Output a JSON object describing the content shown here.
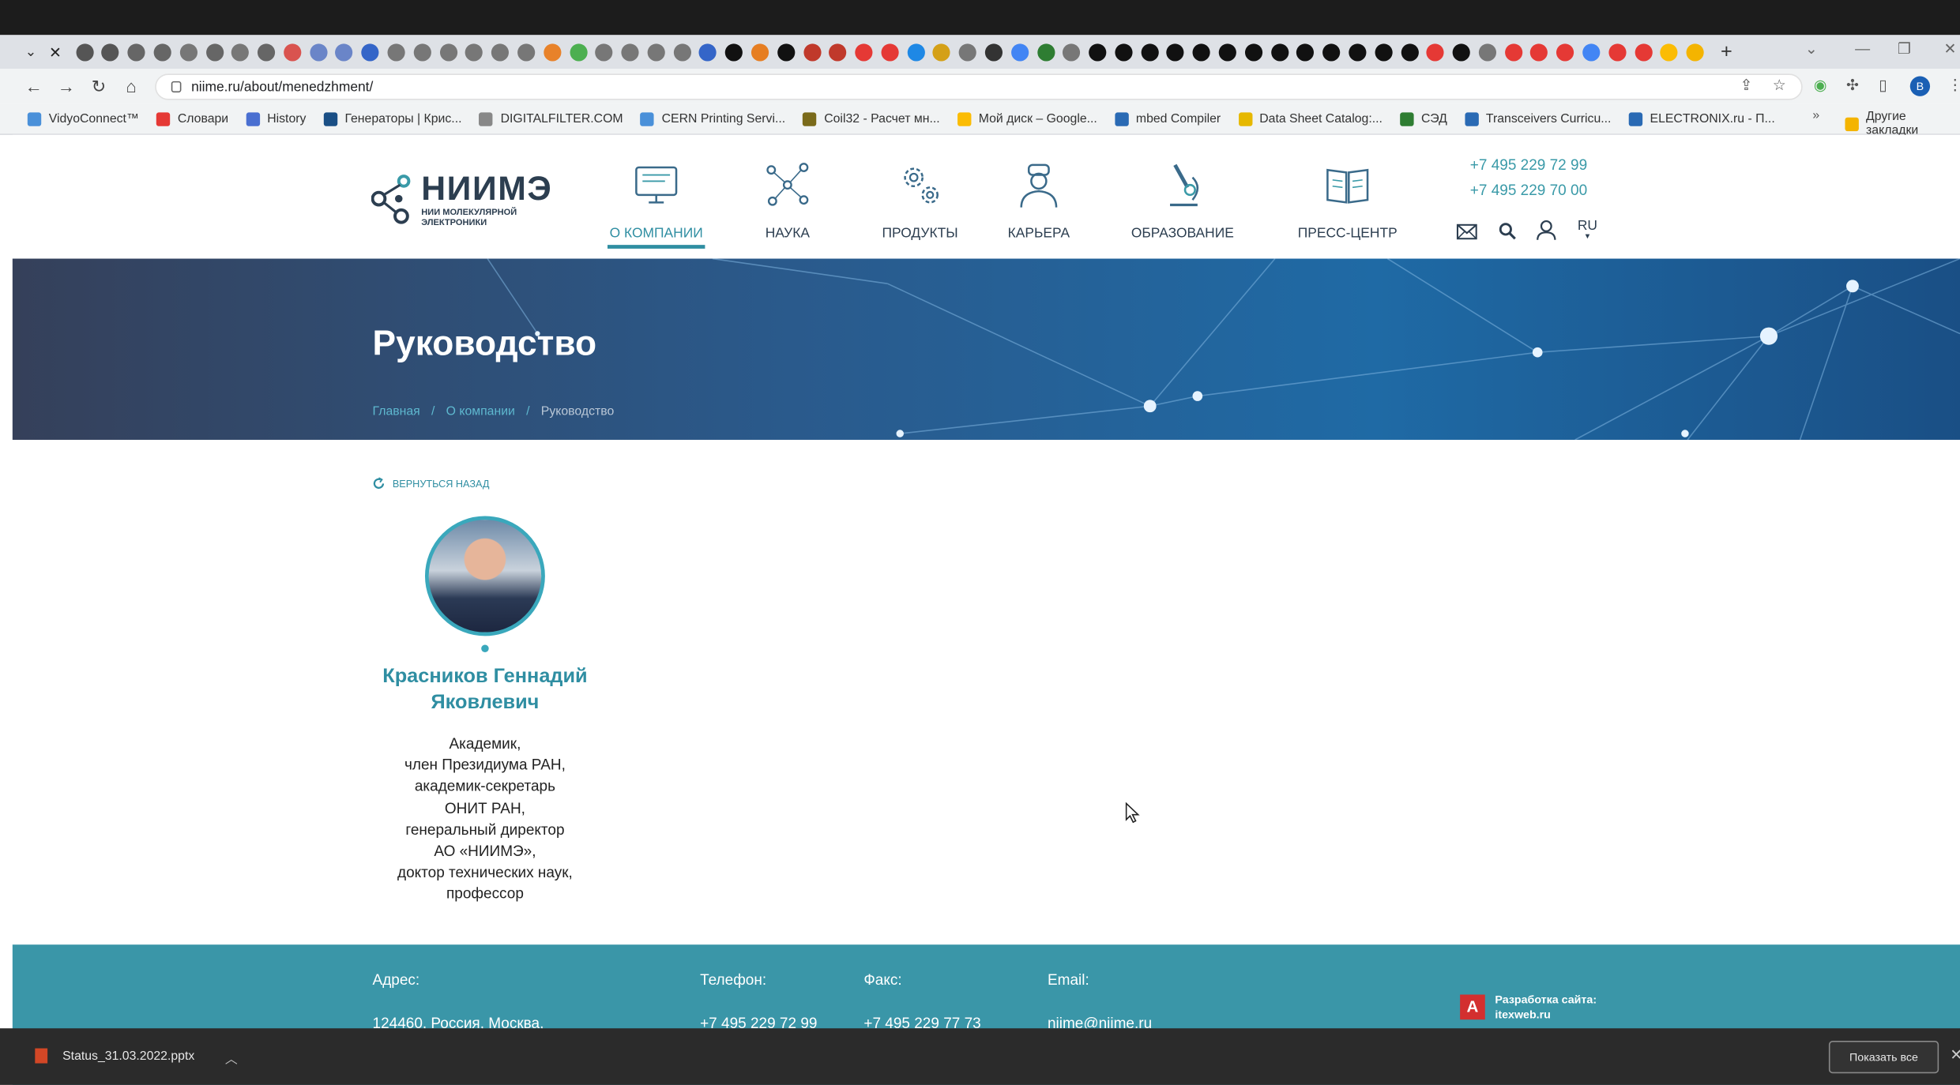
{
  "browser": {
    "url": "niime.ru/about/menedzhment/",
    "tab_colors": [
      "#555",
      "#555",
      "#666",
      "#666",
      "#777",
      "#666",
      "#777",
      "#666",
      "#d9534f",
      "#6a85c8",
      "#6a85c8",
      "#3465c8",
      "#777",
      "#777",
      "#777",
      "#777",
      "#777",
      "#777",
      "#e8822a",
      "#4caf50",
      "#777",
      "#777",
      "#777",
      "#777",
      "#3465c8",
      "#111",
      "#e67e22",
      "#111",
      "#c0392b",
      "#c0392b",
      "#e53935",
      "#e53935",
      "#1e88e5",
      "#d4a017",
      "#777",
      "#333",
      "#4285f4",
      "#2e7d32",
      "#777",
      "#111",
      "#111",
      "#111",
      "#111",
      "#111",
      "#111",
      "#111",
      "#111",
      "#111",
      "#111",
      "#111",
      "#111",
      "#111",
      "#e53935",
      "#111",
      "#777",
      "#e53935",
      "#e53935",
      "#e53935",
      "#4285f4",
      "#e53935",
      "#e53935",
      "#fbbc04",
      "#f4b400"
    ],
    "bookmarks": [
      {
        "label": "VidyoConnect™",
        "color": "#4a90d9"
      },
      {
        "label": "Словари",
        "color": "#e53935"
      },
      {
        "label": "History",
        "color": "#4a6fd1"
      },
      {
        "label": "Генераторы | Крис...",
        "color": "#1a4f85"
      },
      {
        "label": "DIGITALFILTER.COM",
        "color": "#888"
      },
      {
        "label": "CERN Printing Servi...",
        "color": "#4a90d9"
      },
      {
        "label": "Coil32 - Расчет мн...",
        "color": "#7a6a1a"
      },
      {
        "label": "Мой диск – Google...",
        "color": "#fbbc04"
      },
      {
        "label": "mbed Compiler",
        "color": "#2a6ab4"
      },
      {
        "label": "Data Sheet Catalog:...",
        "color": "#e6b800"
      },
      {
        "label": "СЭД",
        "color": "#2e7d32"
      },
      {
        "label": "Transceivers Curricu...",
        "color": "#2a6ab4"
      },
      {
        "label": "ELECTRONIX.ru - П...",
        "color": "#2a6ab4"
      }
    ],
    "bookmarks_overflow": "»",
    "other_bookmarks": "Другие закладки",
    "profile_initial": "B"
  },
  "site": {
    "logo": {
      "name": "НИИМЭ",
      "sub1": "НИИ МОЛЕКУЛЯРНОЙ",
      "sub2": "ЭЛЕКТРОНИКИ"
    },
    "nav": [
      {
        "label": "О КОМПАНИИ",
        "icon": "monitor-icon",
        "active": true
      },
      {
        "label": "НАУКА",
        "icon": "molecule-icon",
        "active": false
      },
      {
        "label": "ПРОДУКТЫ",
        "icon": "gears-icon",
        "active": false
      },
      {
        "label": "КАРЬЕРА",
        "icon": "worker-icon",
        "active": false
      },
      {
        "label": "ОБРАЗОВАНИЕ",
        "icon": "microscope-icon",
        "active": false
      },
      {
        "label": "ПРЕСС-ЦЕНТР",
        "icon": "book-icon",
        "active": false
      }
    ],
    "phones": [
      "+7 495 229 72 99",
      "+7 495 229 70 00"
    ],
    "lang": "RU",
    "banner_title": "Руководство",
    "breadcrumbs": [
      "Главная",
      "О компании",
      "Руководство"
    ],
    "breadcrumb_sep": "/",
    "back_link": "ВЕРНУТЬСЯ НАЗАД",
    "person": {
      "name": "Красников Геннадий Яковлевич",
      "description_lines": [
        "Академик,",
        "член Президиума РАН,",
        "академик-секретарь",
        "ОНИТ РАН,",
        "генеральный директор",
        "АО «НИИМЭ»,",
        "доктор технических наук,",
        "профессор"
      ]
    },
    "footer": {
      "address_label": "Адрес:",
      "address_value": "124460, Россия, Москва,",
      "phone_label": "Телефон:",
      "phone_value": "+7 495 229 72 99",
      "fax_label": "Факс:",
      "fax_value": "+7 495 229 77 73",
      "email_label": "Email:",
      "email_value": "niime@niime.ru",
      "dev_line1": "Разработка сайта:",
      "dev_line2": "itexweb.ru",
      "dev_logo": "A"
    }
  },
  "downloads": {
    "file": "Status_31.03.2022.pptx",
    "show_all": "Показать все"
  }
}
